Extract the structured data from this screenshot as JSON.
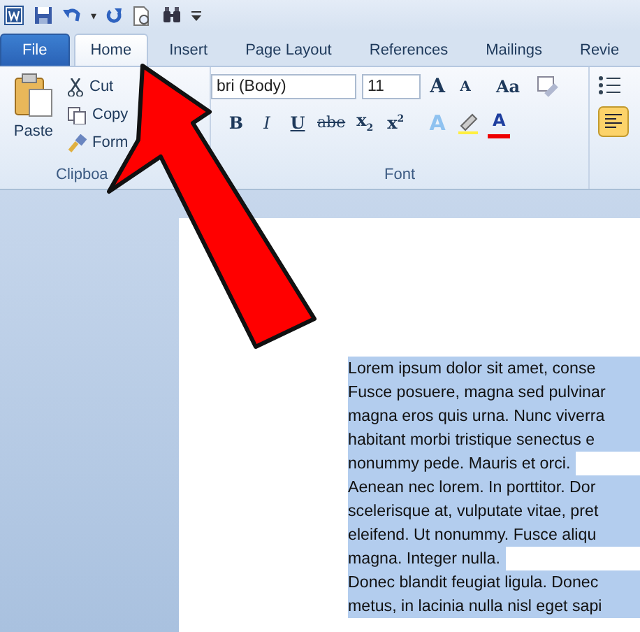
{
  "quick_access": {
    "menu_glyph": "▾"
  },
  "tabs": [
    {
      "label": "File",
      "kind": "file",
      "selected": false
    },
    {
      "label": "Home",
      "kind": "tab",
      "selected": true
    },
    {
      "label": "Insert",
      "kind": "tab",
      "selected": false
    },
    {
      "label": "Page Layout",
      "kind": "tab",
      "selected": false
    },
    {
      "label": "References",
      "kind": "tab",
      "selected": false
    },
    {
      "label": "Mailings",
      "kind": "tab",
      "selected": false
    },
    {
      "label": "Revie",
      "kind": "tab",
      "selected": false
    }
  ],
  "clipboard": {
    "paste": "Paste",
    "cut": "Cut",
    "copy": "Copy",
    "format_painter": "Form",
    "group_label": "Clipboa"
  },
  "font": {
    "font_name": "bri (Body)",
    "font_size": "11",
    "grow": "A",
    "shrink": "A",
    "change_case": "Aa",
    "bold": "B",
    "italic": "I",
    "underline": "U",
    "strikethrough": "abe",
    "subscript": "x",
    "subscript_mark": "2",
    "superscript": "x",
    "superscript_mark": "2",
    "text_effects": "A",
    "font_color": "A",
    "group_label": "Font"
  },
  "paragraph": {
    "align_left_selected": true
  },
  "document": {
    "lines": [
      {
        "text": "Lorem ipsum dolor sit amet, conse",
        "kind": "wrap"
      },
      {
        "text": "Fusce posuere, magna sed pulvinar",
        "kind": "wrap"
      },
      {
        "text": "magna eros quis urna. Nunc viverra",
        "kind": "wrap"
      },
      {
        "text": "habitant morbi tristique senectus e",
        "kind": "wrap"
      },
      {
        "text": "nonummy pede. Mauris et orci.",
        "kind": "end"
      },
      {
        "text": "Aenean nec lorem. In porttitor. Dor",
        "kind": "wrap"
      },
      {
        "text": "scelerisque at, vulputate vitae, pret",
        "kind": "wrap"
      },
      {
        "text": "eleifend. Ut nonummy. Fusce aliqu",
        "kind": "wrap"
      },
      {
        "text": "magna. Integer nulla.",
        "kind": "end"
      },
      {
        "text": "Donec blandit feugiat ligula. Donec",
        "kind": "wrap"
      },
      {
        "text": "metus, in lacinia nulla nisl eget sapi",
        "kind": "wrap"
      }
    ]
  }
}
